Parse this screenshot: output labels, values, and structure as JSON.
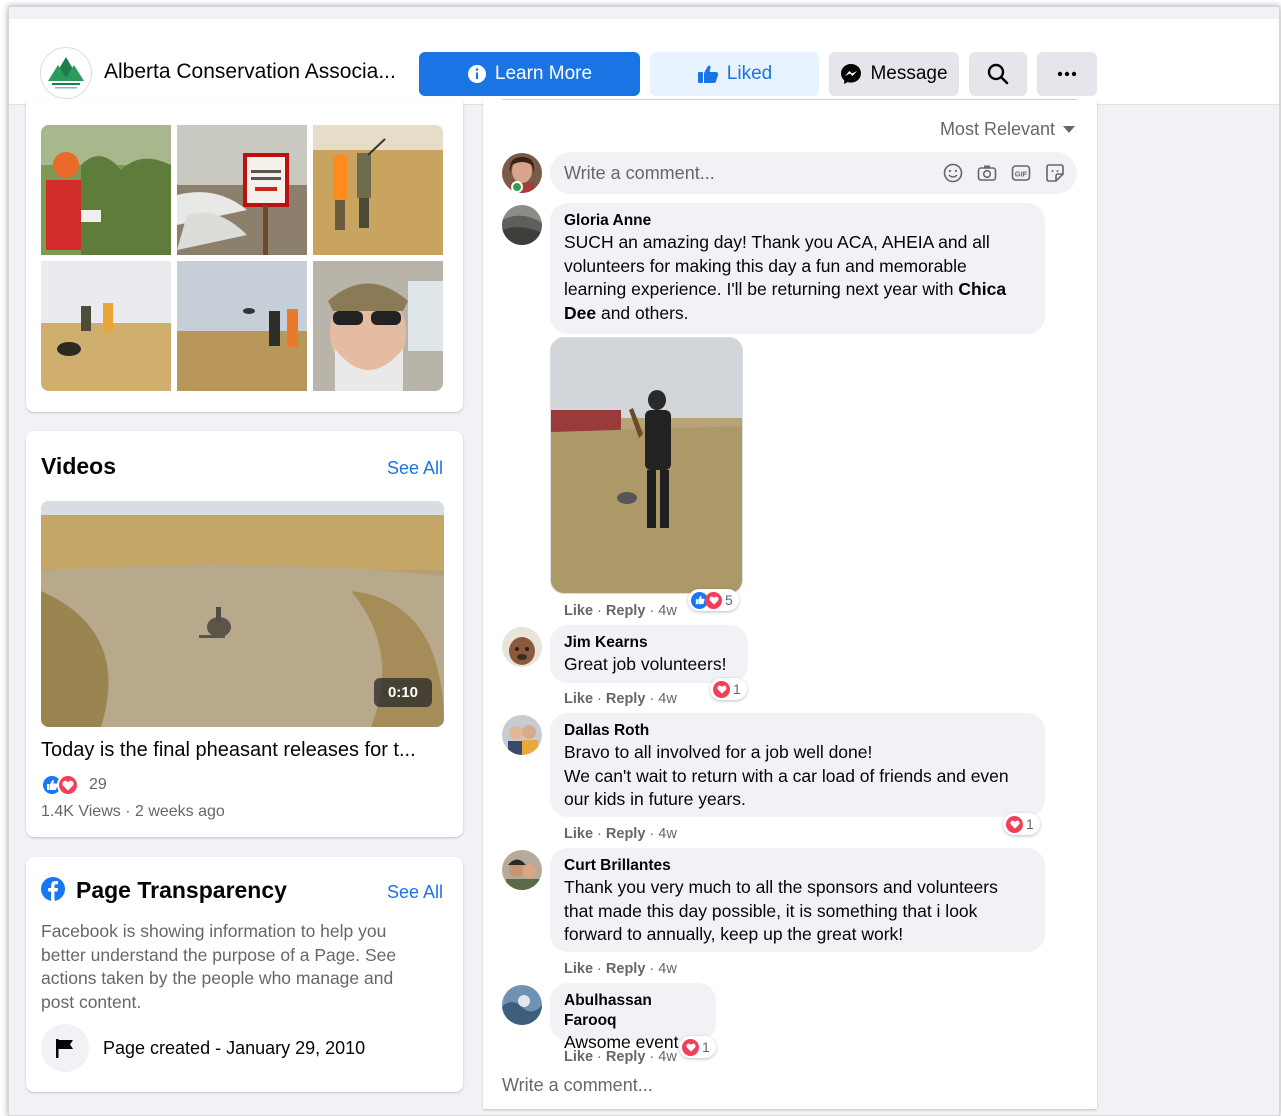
{
  "header": {
    "page_name": "Alberta Conservation Associa...",
    "learn_more": "Learn More",
    "liked": "Liked",
    "message": "Message"
  },
  "videos": {
    "title": "Videos",
    "see_all": "See All",
    "duration": "0:10",
    "video_title": "Today is the final pheasant releases for t...",
    "reaction_count": "29",
    "meta": "1.4K Views · 2 weeks ago"
  },
  "transparency": {
    "title": "Page Transparency",
    "see_all": "See All",
    "description": "Facebook is showing information to help you better understand the purpose of a Page. See actions taken by the people who manage and post content.",
    "created": "Page created - January 29, 2010"
  },
  "comments_panel": {
    "sort_label": "Most Relevant",
    "write_placeholder": "Write a comment...",
    "write_bottom": "Write a comment...",
    "comments": [
      {
        "name": "Gloria Anne",
        "text_a": "SUCH an amazing day! Thank you ACA, AHEIA and all volunteers for making this day a fun and memorable learning experience. I'll be returning next year with ",
        "mention": "Chica Dee",
        "text_b": " and others.",
        "like": "Like",
        "reply": "Reply",
        "time": "4w",
        "reactions": "5"
      },
      {
        "name": "Jim Kearns",
        "text": "Great job volunteers!",
        "like": "Like",
        "reply": "Reply",
        "time": "4w",
        "reactions": "1"
      },
      {
        "name": "Dallas Roth",
        "text_line1": "Bravo to all involved for a job well done!",
        "text_line2": "We can't wait to return with a car load of friends and even our kids in future years.",
        "like": "Like",
        "reply": "Reply",
        "time": "4w",
        "reactions": "1"
      },
      {
        "name": "Curt Brillantes",
        "text": "Thank you very much to all the sponsors and volunteers that made this day possible, it is something that i look forward to annually, keep up the great work!",
        "like": "Like",
        "reply": "Reply",
        "time": "4w"
      },
      {
        "name": "Abulhassan Farooq",
        "text": "Awsome event",
        "like": "Like",
        "reply": "Reply",
        "time": "4w",
        "reactions": "1"
      }
    ]
  },
  "colors": {
    "brand_blue": "#1b74e4",
    "liked_bg": "#e7f3ff",
    "love_red": "#f33e58",
    "secondary_text": "#65676b"
  }
}
